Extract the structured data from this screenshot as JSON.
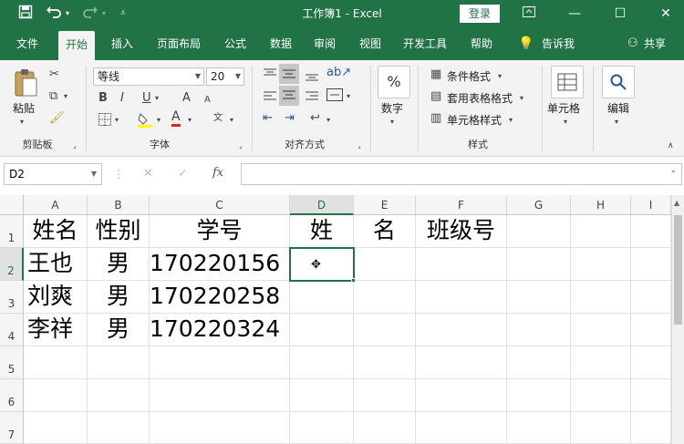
{
  "titlebar": {
    "title": "工作簿1 - Excel",
    "login_label": "登录",
    "save_icon": "save-icon",
    "undo_icon": "undo-icon",
    "redo_icon": "redo-icon",
    "customize_icon": "customize-quick-access-icon"
  },
  "tabs": [
    "文件",
    "开始",
    "插入",
    "页面布局",
    "公式",
    "数据",
    "审阅",
    "视图",
    "开发工具",
    "帮助",
    "告诉我",
    "共享"
  ],
  "active_tab": "开始",
  "ribbon": {
    "clipboard": {
      "paste_label": "粘贴",
      "group_label": "剪贴板"
    },
    "font": {
      "font_name": "等线",
      "font_size": "20",
      "group_label": "字体",
      "bold": "B",
      "italic": "I",
      "underline": "U",
      "grow": "A",
      "shrink": "A",
      "font_color": "A",
      "phonetic": "文"
    },
    "alignment": {
      "group_label": "对齐方式"
    },
    "number": {
      "label": "数字",
      "symbol": "%"
    },
    "styles": {
      "conditional": "条件格式",
      "table": "套用表格格式",
      "cell_styles": "单元格样式",
      "group_label": "样式"
    },
    "cells": {
      "label": "单元格"
    },
    "editing": {
      "label": "编辑"
    }
  },
  "formula_bar": {
    "name_box": "D2",
    "cancel": "✕",
    "enter": "✓",
    "fx": "fx",
    "formula": ""
  },
  "sheet": {
    "columns": [
      "A",
      "B",
      "C",
      "D",
      "E",
      "F",
      "G",
      "H",
      "I"
    ],
    "rows": [
      "1",
      "2",
      "3",
      "4",
      "5",
      "6",
      "7"
    ],
    "selected_cell": "D2",
    "cells": {
      "A1": "姓名",
      "B1": "性别",
      "C1": "学号",
      "D1": "姓",
      "E1": "名",
      "F1": "班级号",
      "A2": "王也",
      "B2": "男",
      "C2": "170220156",
      "A3": "刘爽",
      "B3": "男",
      "C3": "170220258",
      "A4": "李祥",
      "B4": "男",
      "C4": "170220324"
    }
  },
  "colors": {
    "accent": "#217346"
  }
}
